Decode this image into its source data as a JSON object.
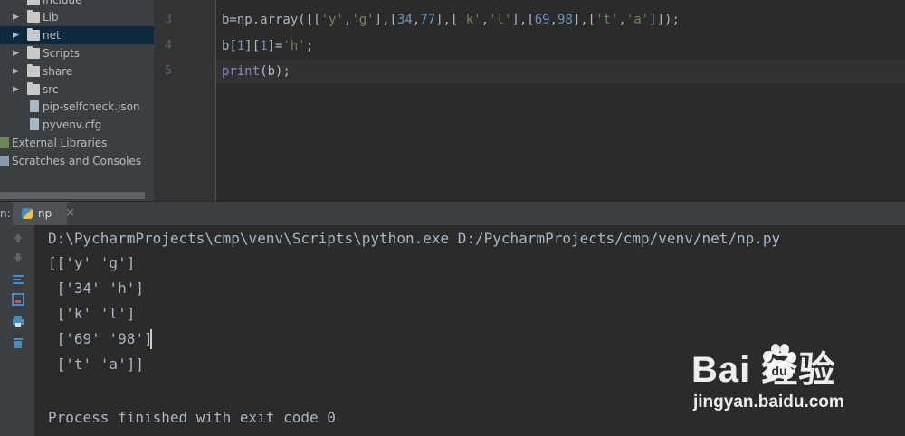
{
  "project_tree": {
    "items": [
      {
        "label": "include",
        "type": "folder",
        "expandable": true
      },
      {
        "label": "Lib",
        "type": "folder",
        "expandable": true
      },
      {
        "label": "net",
        "type": "folder",
        "expandable": true,
        "selected": true
      },
      {
        "label": "Scripts",
        "type": "folder",
        "expandable": true
      },
      {
        "label": "share",
        "type": "folder",
        "expandable": true
      },
      {
        "label": "src",
        "type": "folder",
        "expandable": true
      },
      {
        "label": "pip-selfcheck.json",
        "type": "file"
      },
      {
        "label": "pyvenv.cfg",
        "type": "file"
      },
      {
        "label": "External Libraries",
        "type": "library"
      },
      {
        "label": "Scratches and Consoles",
        "type": "scratch"
      }
    ]
  },
  "editor": {
    "lines": [
      {
        "number": "3",
        "code": "b=np.array([['y','g'],[34,77],['k','l'],[69,98],['t','a']]);"
      },
      {
        "number": "4",
        "code": "b[1][1]='h';"
      },
      {
        "number": "5",
        "code": "print(b);"
      }
    ]
  },
  "run_panel": {
    "label": "n:",
    "tab_name": "np",
    "tab_close": "×",
    "tools": [
      "up-arrow-icon",
      "down-arrow-icon",
      "soft-wrap-icon",
      "scroll-to-end-icon",
      "print-icon",
      "trash-icon"
    ],
    "output": {
      "command": "D:\\PycharmProjects\\cmp\\venv\\Scripts\\python.exe D:/PycharmProjects/cmp/venv/net/np.py",
      "lines": [
        "[['y' 'g']",
        " ['34' 'h']",
        " ['k' 'l']",
        " ['69' '98']",
        " ['t' 'a']]"
      ],
      "exit": "Process finished with exit code 0"
    }
  },
  "watermark": {
    "logo": "Bai  经验",
    "url": "jingyan.baidu.com"
  },
  "colors": {
    "selection": "#0d293e",
    "string": "#6a8759",
    "number": "#6897bb",
    "builtin": "#8888c6",
    "text": "#a9b7c6"
  }
}
